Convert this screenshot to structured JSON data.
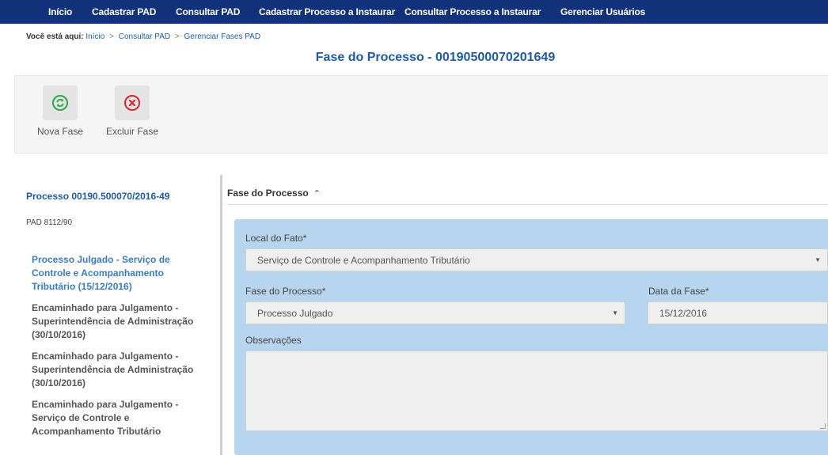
{
  "nav": {
    "items": [
      "Início",
      "Cadastrar PAD",
      "Consultar PAD",
      "Cadastrar Processo a Instaurar",
      "Consultar Processo a Instaurar",
      "Gerenciar Usuários"
    ]
  },
  "breadcrumb": {
    "prefix": "Você está aqui:",
    "crumbs": [
      "Início",
      "Consultar PAD",
      "Gerenciar Fases PAD"
    ],
    "separator": ">"
  },
  "page_title": "Fase do Processo - 00190500070201649",
  "toolbar": {
    "new_phase_label": "Nova Fase",
    "delete_phase_label": "Excluir Fase"
  },
  "sidebar": {
    "process_title": "Processo 00190.500070/2016-49",
    "process_type": "PAD 8112/90",
    "phases": [
      "Processo Julgado - Serviço de Controle e Acompanhamento Tributário (15/12/2016)",
      "Encaminhado para Julgamento - Superintendência de Administração (30/10/2016)",
      "Encaminhado para Julgamento - Superintendência de Administração (30/10/2016)",
      "Encaminhado para Julgamento - Serviço de Controle e Acompanhamento Tributário"
    ]
  },
  "form": {
    "section_title": "Fase do Processo",
    "local_label": "Local do Fato*",
    "local_value": "Serviço de Controle e Acompanhamento Tributário",
    "phase_label": "Fase do Processo*",
    "phase_value": "Processo Julgado",
    "date_label": "Data da Fase*",
    "date_value": "15/12/2016",
    "notes_label": "Observações",
    "notes_value": ""
  },
  "colors": {
    "nav_bg": "#11327a",
    "title_blue": "#1d5ba9",
    "form_bg": "#b8d5ef",
    "active_phase": "#3a7bc8"
  }
}
